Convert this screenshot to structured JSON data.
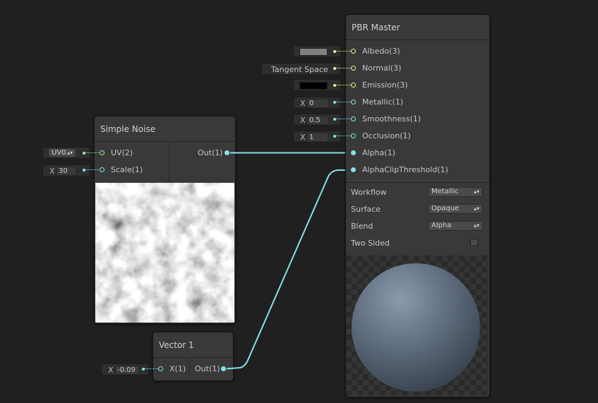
{
  "simple_noise": {
    "title": "Simple Noise",
    "inputs": [
      {
        "label": "UV(2)",
        "value": "UV0"
      },
      {
        "label": "Scale(1)",
        "axis": "X",
        "value": "30"
      }
    ],
    "outputs": [
      {
        "label": "Out(1)"
      }
    ]
  },
  "vector1": {
    "title": "Vector 1",
    "inputs": [
      {
        "label": "X(1)",
        "axis": "X",
        "value": "-0.09"
      }
    ],
    "outputs": [
      {
        "label": "Out(1)"
      }
    ]
  },
  "pbr_master": {
    "title": "PBR Master",
    "ports": [
      {
        "label": "Albedo(3)",
        "kind": "color"
      },
      {
        "label": "Normal(3)",
        "value": "Tangent Space"
      },
      {
        "label": "Emission(3)",
        "kind": "color"
      },
      {
        "label": "Metallic(1)",
        "axis": "X",
        "value": "0"
      },
      {
        "label": "Smoothness(1)",
        "axis": "X",
        "value": "0.5"
      },
      {
        "label": "Occlusion(1)",
        "axis": "X",
        "value": "1"
      },
      {
        "label": "Alpha(1)"
      },
      {
        "label": "AlphaClipThreshold(1)"
      }
    ],
    "settings": [
      {
        "label": "Workflow",
        "value": "Metallic"
      },
      {
        "label": "Surface",
        "value": "Opaque"
      },
      {
        "label": "Blend",
        "value": "Alpha"
      },
      {
        "label": "Two Sided",
        "checked": false
      }
    ]
  },
  "colors": {
    "canvas": "#202020",
    "node_body": "#393939",
    "vector3_port": "#f3f38c",
    "vector1_port": "#84e4e7",
    "vector2_port": "#9aef92",
    "edge": "#84e4e7",
    "albedo_swatch": "#808080",
    "emission_swatch": "#000000"
  }
}
